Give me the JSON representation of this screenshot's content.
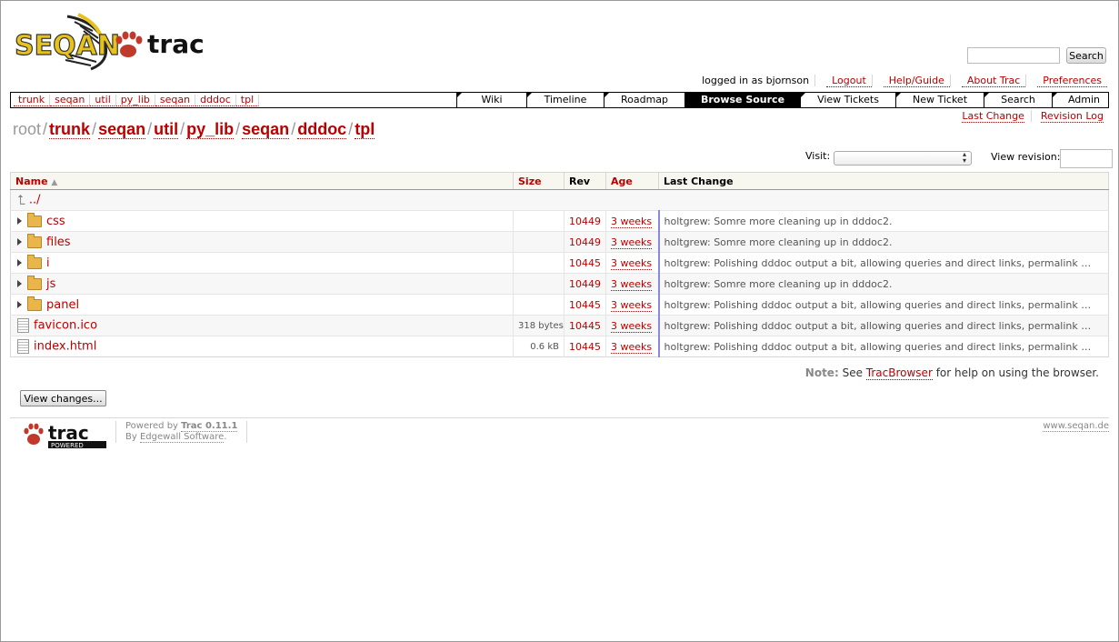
{
  "header": {
    "logo_text_left": "SEQAN",
    "logo_text_right": "trac",
    "search_button": "Search",
    "search_placeholder": ""
  },
  "metanav": {
    "logged_in": "logged in as bjornson",
    "items": [
      "Logout",
      "Help/Guide",
      "About Trac",
      "Preferences"
    ]
  },
  "quicklinks": [
    "trunk",
    "seqan",
    "util",
    "py_lib",
    "seqan",
    "dddoc",
    "tpl"
  ],
  "mainnav": {
    "tabs": [
      "Wiki",
      "Timeline",
      "Roadmap",
      "Browse Source",
      "View Tickets",
      "New Ticket",
      "Search",
      "Admin"
    ],
    "active": "Browse Source"
  },
  "ctxnav": [
    "Last Change",
    "Revision Log"
  ],
  "path": {
    "root": "root",
    "segments": [
      "trunk",
      "seqan",
      "util",
      "py_lib",
      "seqan",
      "dddoc",
      "tpl"
    ],
    "separator": "/"
  },
  "controls": {
    "visit_label": "Visit:",
    "visit_value": "",
    "revision_label": "View revision:",
    "revision_value": ""
  },
  "table": {
    "headers": {
      "name": "Name",
      "size": "Size",
      "rev": "Rev",
      "age": "Age",
      "change": "Last Change"
    },
    "parent": "../",
    "rows": [
      {
        "type": "dir",
        "name": "css",
        "size": "",
        "rev": "10449",
        "age": "3 weeks",
        "change": "holtgrew: Somre more cleaning up in dddoc2."
      },
      {
        "type": "dir",
        "name": "files",
        "size": "",
        "rev": "10449",
        "age": "3 weeks",
        "change": "holtgrew: Somre more cleaning up in dddoc2."
      },
      {
        "type": "dir",
        "name": "i",
        "size": "",
        "rev": "10445",
        "age": "3 weeks",
        "change": "holtgrew: Polishing dddoc output a bit, allowing queries and direct links, permalink …"
      },
      {
        "type": "dir",
        "name": "js",
        "size": "",
        "rev": "10449",
        "age": "3 weeks",
        "change": "holtgrew: Somre more cleaning up in dddoc2."
      },
      {
        "type": "dir",
        "name": "panel",
        "size": "",
        "rev": "10445",
        "age": "3 weeks",
        "change": "holtgrew: Polishing dddoc output a bit, allowing queries and direct links, permalink …"
      },
      {
        "type": "file",
        "name": "favicon.ico",
        "size": "318 bytes",
        "rev": "10445",
        "age": "3 weeks",
        "change": "holtgrew: Polishing dddoc output a bit, allowing queries and direct links, permalink …"
      },
      {
        "type": "file",
        "name": "index.html",
        "size": "0.6 kB",
        "rev": "10445",
        "age": "3 weeks",
        "change": "holtgrew: Polishing dddoc output a bit, allowing queries and direct links, permalink …"
      }
    ]
  },
  "note": {
    "label": "Note:",
    "pre": "See",
    "link": "TracBrowser",
    "post": "for help on using the browser."
  },
  "view_changes_button": "View changes...",
  "footer": {
    "powered_pre": "Powered by",
    "trac_version": "Trac 0.11.1",
    "by_pre": "By",
    "by_link": "Edgewall Software",
    "by_post": ".",
    "site": "www.seqan.de",
    "logo_text": "trac",
    "logo_sub": "POWERED"
  }
}
